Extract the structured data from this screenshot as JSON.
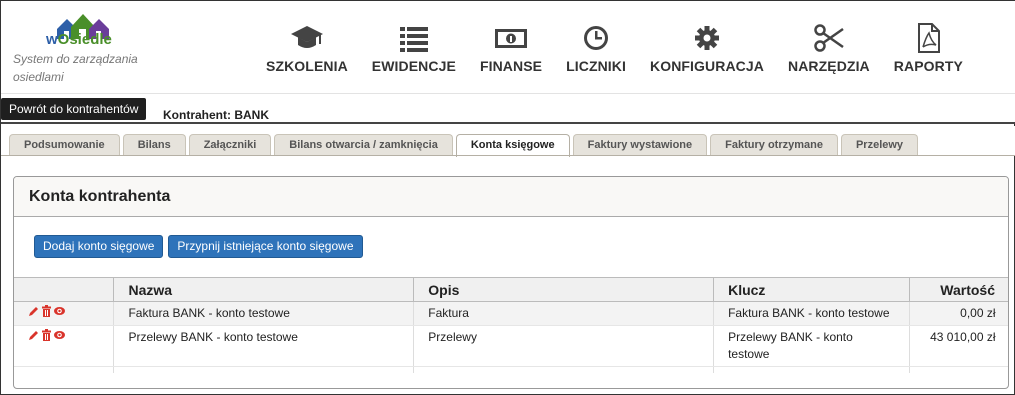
{
  "logo": {
    "text_prefix": "w",
    "text_main": "Osiedle"
  },
  "tagline": "System do zarządzania osiedlami",
  "menu": [
    {
      "label": "SZKOLENIA",
      "icon": "graduation-cap-icon"
    },
    {
      "label": "EWIDENCJE",
      "icon": "list-icon"
    },
    {
      "label": "FINANSE",
      "icon": "banknote-icon"
    },
    {
      "label": "LICZNIKI",
      "icon": "clock-icon"
    },
    {
      "label": "KONFIGURACJA",
      "icon": "gear-icon"
    },
    {
      "label": "NARZĘDZIA",
      "icon": "scissors-icon"
    },
    {
      "label": "RAPORTY",
      "icon": "pdf-file-icon"
    }
  ],
  "subbar": {
    "back_label": "Powrót do kontrahentów",
    "contractor_label": "Kontrahent:",
    "contractor_name": "BANK"
  },
  "tabs": [
    {
      "label": "Podsumowanie",
      "active": false
    },
    {
      "label": "Bilans",
      "active": false
    },
    {
      "label": "Załączniki",
      "active": false
    },
    {
      "label": "Bilans otwarcia / zamknięcia",
      "active": false
    },
    {
      "label": "Konta księgowe",
      "active": true
    },
    {
      "label": "Faktury wystawione",
      "active": false
    },
    {
      "label": "Faktury otrzymane",
      "active": false
    },
    {
      "label": "Przelewy",
      "active": false
    }
  ],
  "panel": {
    "title": "Konta kontrahenta",
    "add_button": "Dodaj konto sięgowe",
    "attach_button": "Przypnij istniejące konto sięgowe"
  },
  "table": {
    "columns": [
      "",
      "Nazwa",
      "Opis",
      "Klucz",
      "Wartość"
    ],
    "rows": [
      {
        "name": "Faktura BANK - konto testowe",
        "description": "Faktura",
        "key": "Faktura BANK - konto testowe",
        "value": "0,00 zł"
      },
      {
        "name": "Przelewy BANK - konto testowe",
        "description": "Przelewy",
        "key": "Przelewy BANK - konto testowe",
        "value": "43 010,00 zł"
      }
    ]
  },
  "colors": {
    "accent_blue": "#2e73ba",
    "action_red": "#d9342b",
    "logo_green": "#4a8f2a",
    "logo_blue": "#2d5fa8"
  }
}
